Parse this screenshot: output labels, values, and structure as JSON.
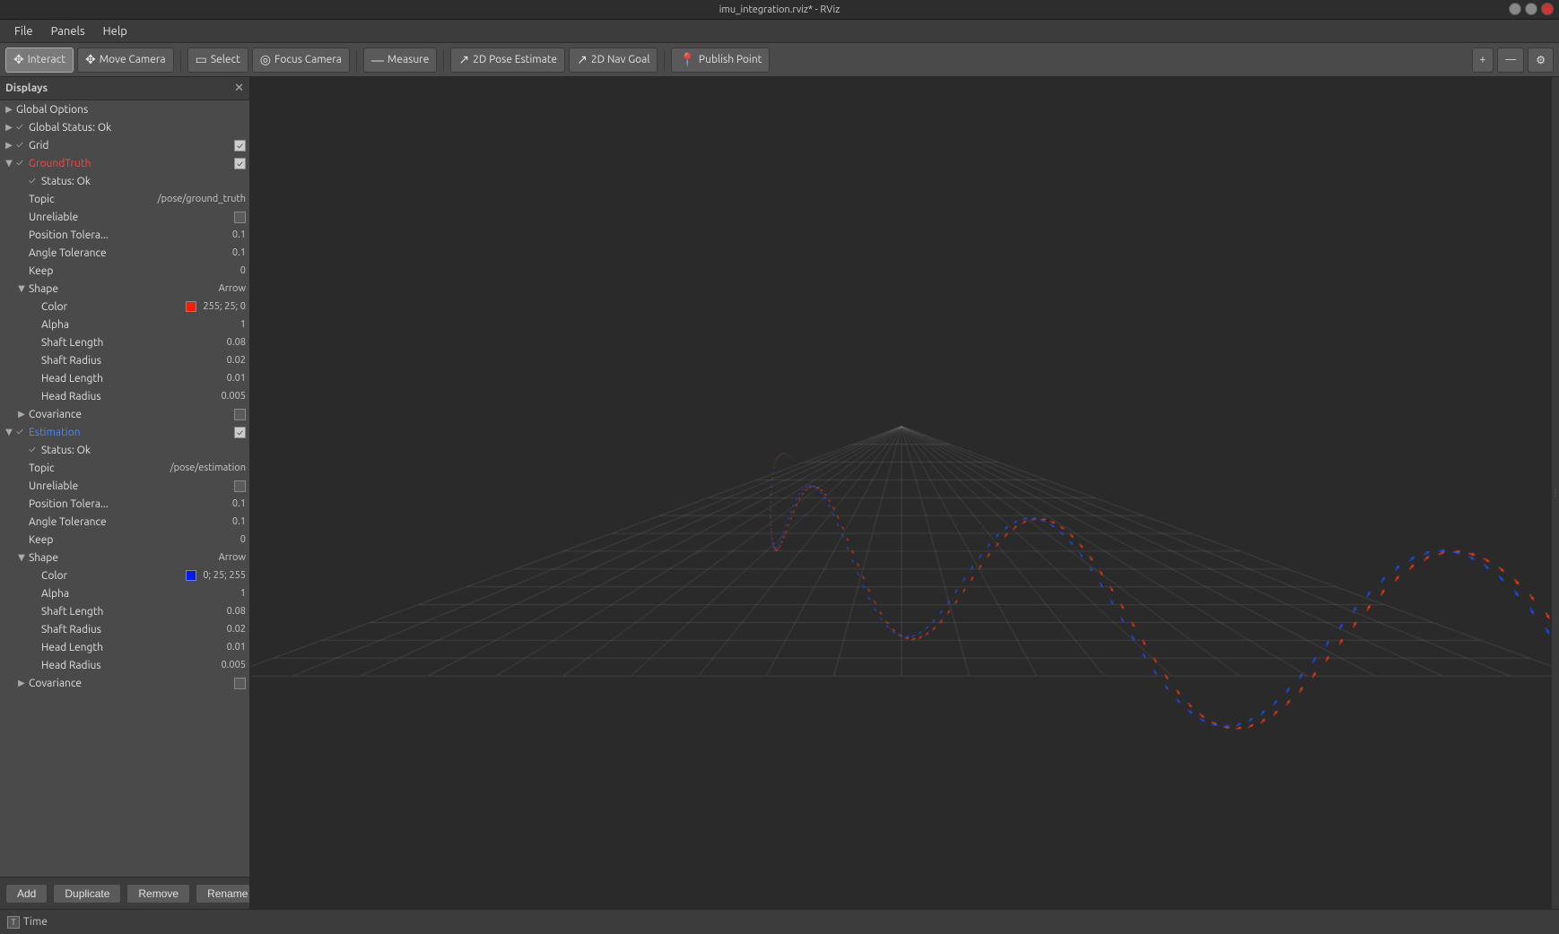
{
  "window": {
    "title": "imu_integration.rviz* - RViz"
  },
  "menubar": {
    "items": [
      "File",
      "Panels",
      "Help"
    ]
  },
  "toolbar": {
    "buttons": [
      {
        "id": "interact",
        "label": "Interact",
        "icon": "✥",
        "active": true
      },
      {
        "id": "move-camera",
        "label": "Move Camera",
        "icon": "✥",
        "active": false
      },
      {
        "id": "select",
        "label": "Select",
        "icon": "▭",
        "active": false
      },
      {
        "id": "focus-camera",
        "label": "Focus Camera",
        "icon": "◎",
        "active": false
      },
      {
        "id": "measure",
        "label": "Measure",
        "icon": "—",
        "active": false
      },
      {
        "id": "2d-pose",
        "label": "2D Pose Estimate",
        "icon": "↗",
        "active": false
      },
      {
        "id": "2d-nav",
        "label": "2D Nav Goal",
        "icon": "↗",
        "active": false
      },
      {
        "id": "publish-point",
        "label": "Publish Point",
        "icon": "📍",
        "active": false
      }
    ],
    "right_buttons": [
      {
        "id": "plus",
        "icon": "+"
      },
      {
        "id": "minus",
        "icon": "—"
      },
      {
        "id": "settings",
        "icon": "⚙"
      }
    ]
  },
  "displays_panel": {
    "title": "Displays",
    "tree": [
      {
        "level": 0,
        "expand": "▶",
        "check": null,
        "label": "Global Options",
        "value": "",
        "color": null,
        "label_class": ""
      },
      {
        "level": 0,
        "expand": "▶",
        "check": "✓",
        "label": "Global Status: Ok",
        "value": "",
        "color": null,
        "label_class": ""
      },
      {
        "level": 0,
        "expand": "▶",
        "check": "✓",
        "label": "Grid",
        "value": "",
        "color": null,
        "label_class": "",
        "checkbox_right": true
      },
      {
        "level": 0,
        "expand": "▼",
        "check": "✓",
        "label": "GroundTruth",
        "value": "",
        "color": null,
        "label_class": "red",
        "checkbox_right": true
      },
      {
        "level": 1,
        "expand": null,
        "check": "✓",
        "label": "Status: Ok",
        "value": "",
        "color": null,
        "label_class": ""
      },
      {
        "level": 1,
        "expand": null,
        "check": null,
        "label": "Topic",
        "value": "/pose/ground_truth",
        "color": null,
        "label_class": ""
      },
      {
        "level": 1,
        "expand": null,
        "check": null,
        "label": "Unreliable",
        "value": "",
        "color": null,
        "label_class": "",
        "checkbox_right": true
      },
      {
        "level": 1,
        "expand": null,
        "check": null,
        "label": "Position Tolera...",
        "value": "0.1",
        "color": null,
        "label_class": ""
      },
      {
        "level": 1,
        "expand": null,
        "check": null,
        "label": "Angle Tolerance",
        "value": "0.1",
        "color": null,
        "label_class": ""
      },
      {
        "level": 1,
        "expand": null,
        "check": null,
        "label": "Keep",
        "value": "0",
        "color": null,
        "label_class": ""
      },
      {
        "level": 1,
        "expand": "▼",
        "check": null,
        "label": "Shape",
        "value": "Arrow",
        "color": null,
        "label_class": ""
      },
      {
        "level": 2,
        "expand": null,
        "check": null,
        "label": "Color",
        "value": "255; 25; 0",
        "color": "#ff1900",
        "label_class": ""
      },
      {
        "level": 2,
        "expand": null,
        "check": null,
        "label": "Alpha",
        "value": "1",
        "color": null,
        "label_class": ""
      },
      {
        "level": 2,
        "expand": null,
        "check": null,
        "label": "Shaft Length",
        "value": "0.08",
        "color": null,
        "label_class": ""
      },
      {
        "level": 2,
        "expand": null,
        "check": null,
        "label": "Shaft Radius",
        "value": "0.02",
        "color": null,
        "label_class": ""
      },
      {
        "level": 2,
        "expand": null,
        "check": null,
        "label": "Head Length",
        "value": "0.01",
        "color": null,
        "label_class": ""
      },
      {
        "level": 2,
        "expand": null,
        "check": null,
        "label": "Head Radius",
        "value": "0.005",
        "color": null,
        "label_class": ""
      },
      {
        "level": 1,
        "expand": "▶",
        "check": null,
        "label": "Covariance",
        "value": "",
        "color": null,
        "label_class": "",
        "checkbox_right": true
      },
      {
        "level": 0,
        "expand": "▼",
        "check": "✓",
        "label": "Estimation",
        "value": "",
        "color": null,
        "label_class": "blue",
        "checkbox_right": true
      },
      {
        "level": 1,
        "expand": null,
        "check": "✓",
        "label": "Status: Ok",
        "value": "",
        "color": null,
        "label_class": ""
      },
      {
        "level": 1,
        "expand": null,
        "check": null,
        "label": "Topic",
        "value": "/pose/estimation",
        "color": null,
        "label_class": ""
      },
      {
        "level": 1,
        "expand": null,
        "check": null,
        "label": "Unreliable",
        "value": "",
        "color": null,
        "label_class": "",
        "checkbox_right": true
      },
      {
        "level": 1,
        "expand": null,
        "check": null,
        "label": "Position Tolera...",
        "value": "0.1",
        "color": null,
        "label_class": ""
      },
      {
        "level": 1,
        "expand": null,
        "check": null,
        "label": "Angle Tolerance",
        "value": "0.1",
        "color": null,
        "label_class": ""
      },
      {
        "level": 1,
        "expand": null,
        "check": null,
        "label": "Keep",
        "value": "0",
        "color": null,
        "label_class": ""
      },
      {
        "level": 1,
        "expand": "▼",
        "check": null,
        "label": "Shape",
        "value": "Arrow",
        "color": null,
        "label_class": ""
      },
      {
        "level": 2,
        "expand": null,
        "check": null,
        "label": "Color",
        "value": "0; 25; 255",
        "color": "#0019ff",
        "label_class": ""
      },
      {
        "level": 2,
        "expand": null,
        "check": null,
        "label": "Alpha",
        "value": "1",
        "color": null,
        "label_class": ""
      },
      {
        "level": 2,
        "expand": null,
        "check": null,
        "label": "Shaft Length",
        "value": "0.08",
        "color": null,
        "label_class": ""
      },
      {
        "level": 2,
        "expand": null,
        "check": null,
        "label": "Shaft Radius",
        "value": "0.02",
        "color": null,
        "label_class": ""
      },
      {
        "level": 2,
        "expand": null,
        "check": null,
        "label": "Head Length",
        "value": "0.01",
        "color": null,
        "label_class": ""
      },
      {
        "level": 2,
        "expand": null,
        "check": null,
        "label": "Head Radius",
        "value": "0.005",
        "color": null,
        "label_class": ""
      },
      {
        "level": 1,
        "expand": "▶",
        "check": null,
        "label": "Covariance",
        "value": "",
        "color": null,
        "label_class": "",
        "checkbox_right": true
      }
    ],
    "buttons": [
      "Add",
      "Duplicate",
      "Remove",
      "Rename"
    ]
  },
  "statusbar": {
    "label": "Time"
  },
  "colors": {
    "accent_red": "#ff4444",
    "accent_blue": "#4488ff",
    "bg_dark": "#2a2a2a",
    "bg_panel": "#4a4a4a",
    "bg_header": "#3c3c3c"
  }
}
